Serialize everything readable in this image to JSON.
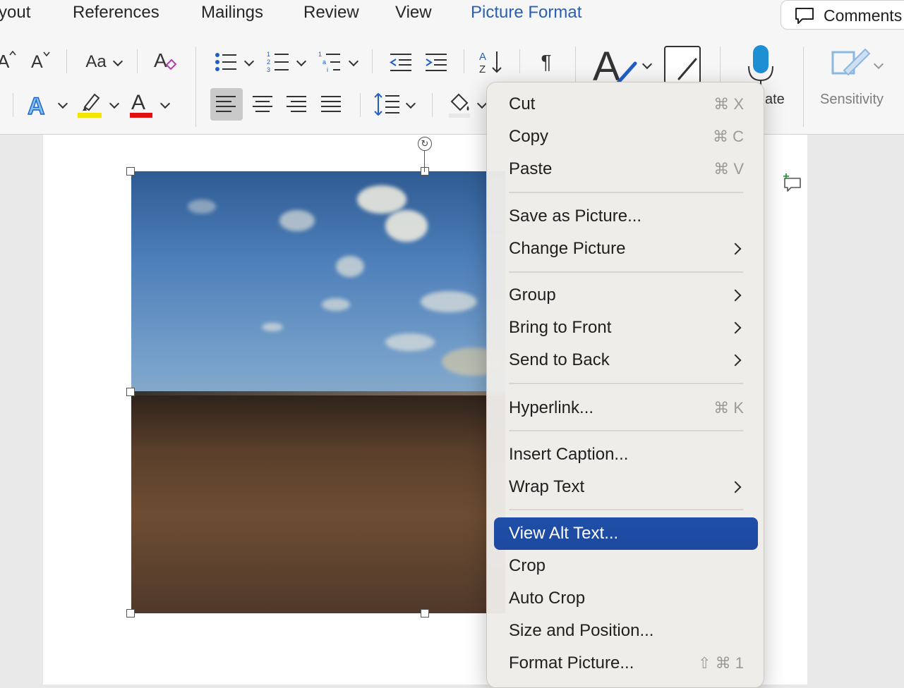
{
  "ribbon": {
    "tabs": [
      {
        "label": "yout",
        "active": false
      },
      {
        "label": "References",
        "active": false
      },
      {
        "label": "Mailings",
        "active": false
      },
      {
        "label": "Review",
        "active": false
      },
      {
        "label": "View",
        "active": false
      },
      {
        "label": "Picture Format",
        "active": true
      }
    ],
    "comments_label": "Comments",
    "font_case_label": "Aa",
    "dictate_label": "ate",
    "sensitivity_label": "Sensitivity",
    "colors": {
      "highlight": "#f2e600",
      "font_color": "#e01010",
      "text_effects": "#2a7fd4",
      "active_tab": "#2b5fb3",
      "menu_highlight": "#1f4fa8"
    }
  },
  "context_menu": {
    "items": [
      {
        "label": "Cut",
        "shortcut": "⌘ X"
      },
      {
        "label": "Copy",
        "shortcut": "⌘ C"
      },
      {
        "label": "Paste",
        "shortcut": "⌘ V"
      },
      {
        "label": "Save as Picture...",
        "shortcut": ""
      },
      {
        "label": "Change Picture",
        "submenu": true
      },
      {
        "label": "Group",
        "submenu": true
      },
      {
        "label": "Bring to Front",
        "submenu": true
      },
      {
        "label": "Send to Back",
        "submenu": true
      },
      {
        "label": "Hyperlink...",
        "shortcut": "⌘ K"
      },
      {
        "label": "Insert Caption...",
        "shortcut": ""
      },
      {
        "label": "Wrap Text",
        "submenu": true
      },
      {
        "label": "View Alt Text...",
        "highlighted": true
      },
      {
        "label": "Crop",
        "shortcut": ""
      },
      {
        "label": "Auto Crop",
        "shortcut": ""
      },
      {
        "label": "Size and Position...",
        "shortcut": ""
      },
      {
        "label": "Format Picture...",
        "shortcut": "⇧ ⌘ 1"
      }
    ]
  }
}
